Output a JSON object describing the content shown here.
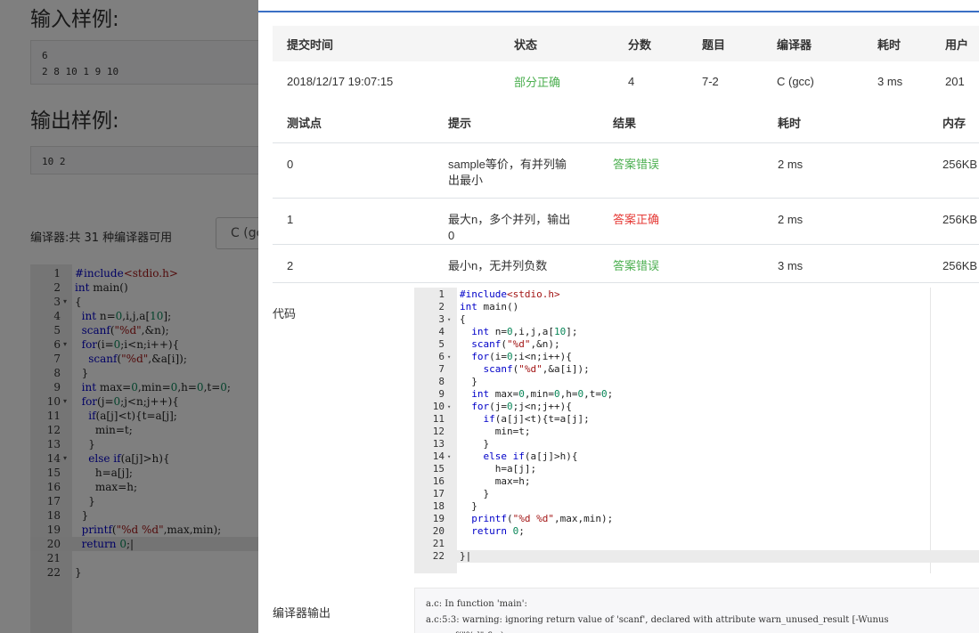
{
  "background": {
    "input_heading": "输入样例:",
    "input_sample": "6\n2 8 10 1 9 10",
    "output_heading": "输出样例:",
    "output_sample": "10 2",
    "compiler_count": "编译器:共 31 种编译器可用",
    "compiler_select": "C (gc",
    "editor_lines": [
      {
        "n": "1",
        "fold": "",
        "html": "<span class=\"kw\">#include</span><span class=\"hdr\">&lt;stdio.h&gt;</span>"
      },
      {
        "n": "2",
        "fold": "",
        "html": "<span class=\"kw\">int</span> main()"
      },
      {
        "n": "3",
        "fold": "▾",
        "html": "{"
      },
      {
        "n": "4",
        "fold": "",
        "html": "  <span class=\"kw\">int</span> n=<span class=\"num\">0</span>,i,j,a[<span class=\"num\">10</span>];"
      },
      {
        "n": "5",
        "fold": "",
        "html": "  <span class=\"kw\">scanf</span>(<span class=\"str\">\"%d\"</span>,&amp;n);"
      },
      {
        "n": "6",
        "fold": "▾",
        "html": "  <span class=\"kw\">for</span>(i=<span class=\"num\">0</span>;i&lt;n;i++){"
      },
      {
        "n": "7",
        "fold": "",
        "html": "    <span class=\"kw\">scanf</span>(<span class=\"str\">\"%d\"</span>,&amp;a[i]);"
      },
      {
        "n": "8",
        "fold": "",
        "html": "  }"
      },
      {
        "n": "9",
        "fold": "",
        "html": "  <span class=\"kw\">int</span> max=<span class=\"num\">0</span>,min=<span class=\"num\">0</span>,h=<span class=\"num\">0</span>,t=<span class=\"num\">0</span>;"
      },
      {
        "n": "10",
        "fold": "▾",
        "html": "  <span class=\"kw\">for</span>(j=<span class=\"num\">0</span>;j&lt;n;j++){"
      },
      {
        "n": "11",
        "fold": "",
        "html": "    <span class=\"kw\">if</span>(a[j]&lt;t){t=a[j];"
      },
      {
        "n": "12",
        "fold": "",
        "html": "      min=t;"
      },
      {
        "n": "13",
        "fold": "",
        "html": "    }"
      },
      {
        "n": "14",
        "fold": "▾",
        "html": "    <span class=\"kw\">else if</span>(a[j]&gt;h){"
      },
      {
        "n": "15",
        "fold": "",
        "html": "      h=a[j];"
      },
      {
        "n": "16",
        "fold": "",
        "html": "      max=h;"
      },
      {
        "n": "17",
        "fold": "",
        "html": "    }"
      },
      {
        "n": "18",
        "fold": "",
        "html": "  }"
      },
      {
        "n": "19",
        "fold": "",
        "html": "  <span class=\"kw\">printf</span>(<span class=\"str\">\"%d %d\"</span>,max,min);"
      },
      {
        "n": "20",
        "fold": "",
        "html": "  <span class=\"kw\">return</span> <span class=\"num\">0</span>;|"
      },
      {
        "n": "21",
        "fold": "",
        "html": ""
      },
      {
        "n": "22",
        "fold": "",
        "html": "}"
      }
    ]
  },
  "submission": {
    "headers": [
      "提交时间",
      "状态",
      "分数",
      "题目",
      "编译器",
      "耗时",
      "用户"
    ],
    "row": {
      "time": "2018/12/17 19:07:15",
      "status": "部分正确",
      "score": "4",
      "problem": "7-2",
      "compiler": "C (gcc)",
      "elapsed": "3 ms",
      "user": "201"
    }
  },
  "tests": {
    "headers": [
      "测试点",
      "提示",
      "结果",
      "耗时",
      "内存"
    ],
    "rows": [
      {
        "id": "0",
        "hint": "sample等价，有并列输出最小",
        "result": "答案错误",
        "result_kind": "wrong",
        "time": "2 ms",
        "memory": "256KB"
      },
      {
        "id": "1",
        "hint": "最大n，多个并列，输出0",
        "result": "答案正确",
        "result_kind": "right",
        "time": "2 ms",
        "memory": "256KB"
      },
      {
        "id": "2",
        "hint": "最小n，无并列负数",
        "result": "答案错误",
        "result_kind": "wrong",
        "time": "3 ms",
        "memory": "256KB"
      }
    ]
  },
  "code_label": "代码",
  "output_label": "编译器输出",
  "code_lines": [
    {
      "n": "1",
      "fold": "",
      "html": "<span class=\"kw\">#include</span><span class=\"hdr\">&lt;stdio.h&gt;</span>"
    },
    {
      "n": "2",
      "fold": "",
      "html": "<span class=\"kw\">int</span> main()"
    },
    {
      "n": "3",
      "fold": "▾",
      "html": "{"
    },
    {
      "n": "4",
      "fold": "",
      "html": "  <span class=\"kw\">int</span> n=<span class=\"num\">0</span>,i,j,a[<span class=\"num\">10</span>];"
    },
    {
      "n": "5",
      "fold": "",
      "html": "  <span class=\"kw\">scanf</span>(<span class=\"str\">\"%d\"</span>,&amp;n);"
    },
    {
      "n": "6",
      "fold": "▾",
      "html": "  <span class=\"kw\">for</span>(i=<span class=\"num\">0</span>;i&lt;n;i++){"
    },
    {
      "n": "7",
      "fold": "",
      "html": "    <span class=\"kw\">scanf</span>(<span class=\"str\">\"%d\"</span>,&amp;a[i]);"
    },
    {
      "n": "8",
      "fold": "",
      "html": "  }"
    },
    {
      "n": "9",
      "fold": "",
      "html": "  <span class=\"kw\">int</span> max=<span class=\"num\">0</span>,min=<span class=\"num\">0</span>,h=<span class=\"num\">0</span>,t=<span class=\"num\">0</span>;"
    },
    {
      "n": "10",
      "fold": "▾",
      "html": "  <span class=\"kw\">for</span>(j=<span class=\"num\">0</span>;j&lt;n;j++){"
    },
    {
      "n": "11",
      "fold": "",
      "html": "    <span class=\"kw\">if</span>(a[j]&lt;t){t=a[j];"
    },
    {
      "n": "12",
      "fold": "",
      "html": "      min=t;"
    },
    {
      "n": "13",
      "fold": "",
      "html": "    }"
    },
    {
      "n": "14",
      "fold": "▾",
      "html": "    <span class=\"kw\">else if</span>(a[j]&gt;h){"
    },
    {
      "n": "15",
      "fold": "",
      "html": "      h=a[j];"
    },
    {
      "n": "16",
      "fold": "",
      "html": "      max=h;"
    },
    {
      "n": "17",
      "fold": "",
      "html": "    }"
    },
    {
      "n": "18",
      "fold": "",
      "html": "  }"
    },
    {
      "n": "19",
      "fold": "",
      "html": "  <span class=\"kw\">printf</span>(<span class=\"str\">\"%d %d\"</span>,max,min);"
    },
    {
      "n": "20",
      "fold": "",
      "html": "  <span class=\"kw\">return</span> <span class=\"num\">0</span>;"
    },
    {
      "n": "21",
      "fold": "",
      "html": ""
    },
    {
      "n": "22",
      "fold": "",
      "html": "}|"
    }
  ],
  "compiler_output": "a.c: In function 'main':\na.c:5:3: warning: ignoring return value of 'scanf', declared with attribute warn_unused_result [-Wunus\n   scanf(\"%d\",&n);",
  "colors": {
    "accent": "#3a6fc4",
    "status_green": "#4caf50",
    "status_red": "#e53935"
  }
}
